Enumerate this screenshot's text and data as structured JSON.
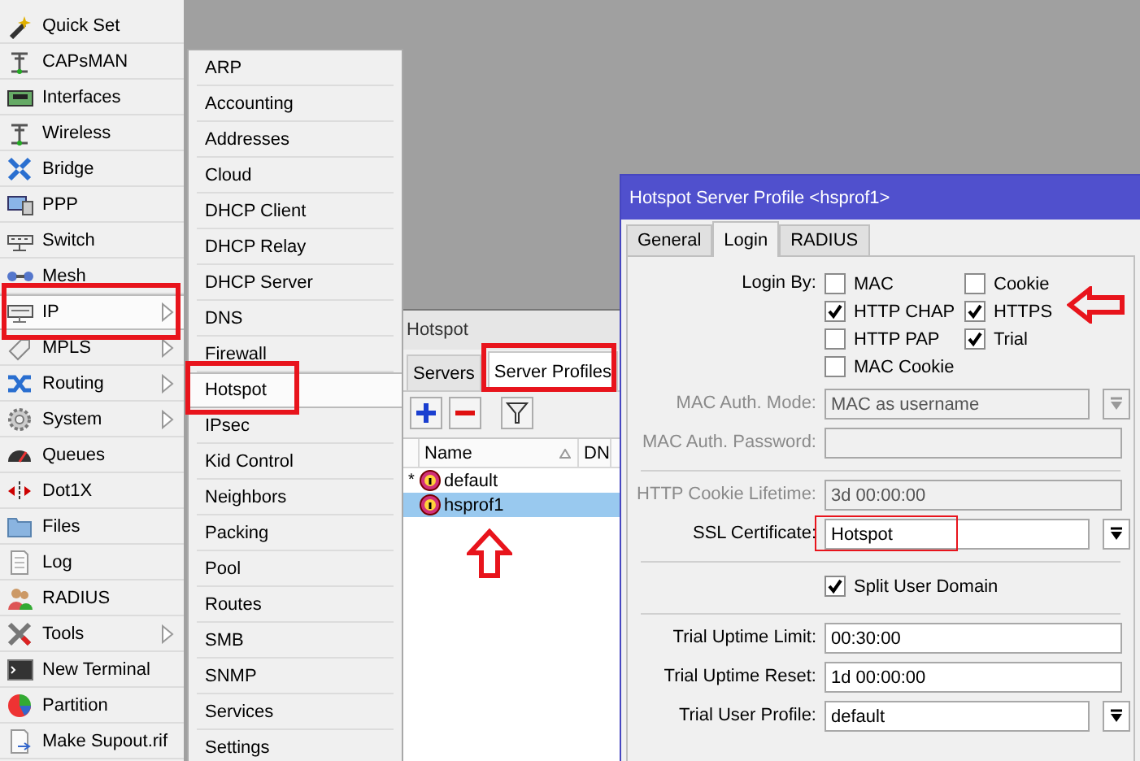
{
  "main_menu": {
    "items": [
      {
        "label": "Quick Set",
        "selected": false,
        "has_submenu": false
      },
      {
        "label": "CAPsMAN",
        "selected": false,
        "has_submenu": false
      },
      {
        "label": "Interfaces",
        "selected": false,
        "has_submenu": false
      },
      {
        "label": "Wireless",
        "selected": false,
        "has_submenu": false
      },
      {
        "label": "Bridge",
        "selected": false,
        "has_submenu": false
      },
      {
        "label": "PPP",
        "selected": false,
        "has_submenu": false
      },
      {
        "label": "Switch",
        "selected": false,
        "has_submenu": false
      },
      {
        "label": "Mesh",
        "selected": false,
        "has_submenu": false
      },
      {
        "label": "IP",
        "selected": true,
        "has_submenu": true
      },
      {
        "label": "MPLS",
        "selected": false,
        "has_submenu": true
      },
      {
        "label": "Routing",
        "selected": false,
        "has_submenu": true
      },
      {
        "label": "System",
        "selected": false,
        "has_submenu": true
      },
      {
        "label": "Queues",
        "selected": false,
        "has_submenu": false
      },
      {
        "label": "Dot1X",
        "selected": false,
        "has_submenu": false
      },
      {
        "label": "Files",
        "selected": false,
        "has_submenu": false
      },
      {
        "label": "Log",
        "selected": false,
        "has_submenu": false
      },
      {
        "label": "RADIUS",
        "selected": false,
        "has_submenu": false
      },
      {
        "label": "Tools",
        "selected": false,
        "has_submenu": true
      },
      {
        "label": "New Terminal",
        "selected": false,
        "has_submenu": false
      },
      {
        "label": "Partition",
        "selected": false,
        "has_submenu": false
      },
      {
        "label": "Make Supout.rif",
        "selected": false,
        "has_submenu": false
      }
    ]
  },
  "ip_submenu": {
    "items": [
      {
        "label": "ARP",
        "selected": false
      },
      {
        "label": "Accounting",
        "selected": false
      },
      {
        "label": "Addresses",
        "selected": false
      },
      {
        "label": "Cloud",
        "selected": false
      },
      {
        "label": "DHCP Client",
        "selected": false
      },
      {
        "label": "DHCP Relay",
        "selected": false
      },
      {
        "label": "DHCP Server",
        "selected": false
      },
      {
        "label": "DNS",
        "selected": false
      },
      {
        "label": "Firewall",
        "selected": false
      },
      {
        "label": "Hotspot",
        "selected": true
      },
      {
        "label": "IPsec",
        "selected": false
      },
      {
        "label": "Kid Control",
        "selected": false
      },
      {
        "label": "Neighbors",
        "selected": false
      },
      {
        "label": "Packing",
        "selected": false
      },
      {
        "label": "Pool",
        "selected": false
      },
      {
        "label": "Routes",
        "selected": false
      },
      {
        "label": "SMB",
        "selected": false
      },
      {
        "label": "SNMP",
        "selected": false
      },
      {
        "label": "Services",
        "selected": false
      },
      {
        "label": "Settings",
        "selected": false
      }
    ]
  },
  "hotspot_window": {
    "title": "Hotspot",
    "tabs": [
      {
        "label": "Servers",
        "selected": false
      },
      {
        "label": "Server Profiles",
        "selected": true
      }
    ],
    "table": {
      "columns": [
        "Name",
        "DN"
      ],
      "rows": [
        {
          "marker": "*",
          "name": "default",
          "selected": false
        },
        {
          "name": "hsprof1",
          "selected": true
        }
      ]
    }
  },
  "profile_window": {
    "title": "Hotspot Server Profile <hsprof1>",
    "tabs": [
      {
        "label": "General",
        "selected": false
      },
      {
        "label": "Login",
        "selected": true
      },
      {
        "label": "RADIUS",
        "selected": false
      }
    ],
    "login_by": {
      "label": "Login By:",
      "options": [
        {
          "label": "MAC",
          "checked": false
        },
        {
          "label": "Cookie",
          "checked": false
        },
        {
          "label": "HTTP CHAP",
          "checked": true
        },
        {
          "label": "HTTPS",
          "checked": true
        },
        {
          "label": "HTTP PAP",
          "checked": false
        },
        {
          "label": "Trial",
          "checked": true
        },
        {
          "label": "MAC Cookie",
          "checked": false
        }
      ]
    },
    "groups": [
      [
        {
          "kind": "dropdown",
          "label": "MAC Auth. Mode:",
          "value": "MAC as username",
          "disabled": true
        },
        {
          "kind": "text",
          "label": "MAC Auth. Password:",
          "disabled": true
        }
      ],
      [
        {
          "kind": "text",
          "label": "HTTP Cookie Lifetime:",
          "value": "3d 00:00:00",
          "disabled": true
        },
        {
          "kind": "dropdown",
          "label": "SSL Certificate:",
          "value": "Hotspot",
          "disabled": false
        }
      ],
      [
        {
          "kind": "checkbox",
          "label": "Split User Domain",
          "checked": true
        }
      ],
      [
        {
          "kind": "text",
          "label": "Trial Uptime Limit:",
          "value": "00:30:00",
          "disabled": false
        },
        {
          "kind": "text",
          "label": "Trial Uptime Reset:",
          "value": "1d 00:00:00",
          "disabled": false
        },
        {
          "kind": "dropdown",
          "label": "Trial User Profile:",
          "value": "default",
          "disabled": false
        }
      ]
    ]
  }
}
